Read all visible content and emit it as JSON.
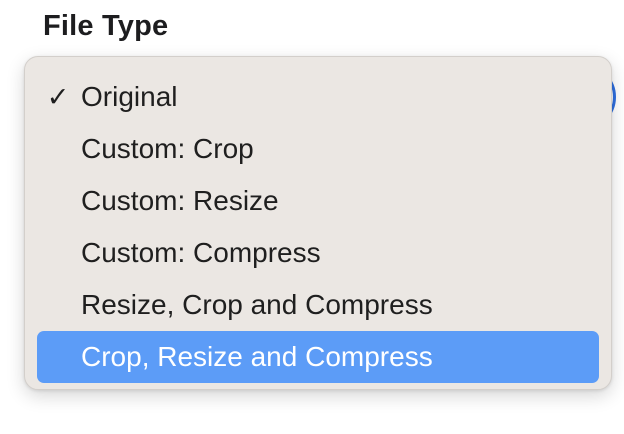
{
  "section": {
    "label": "File Type"
  },
  "menu": {
    "checked_index": 0,
    "highlighted_index": 5,
    "check_glyph": "✓",
    "items": [
      {
        "label": "Original"
      },
      {
        "label": "Custom: Crop"
      },
      {
        "label": "Custom: Resize"
      },
      {
        "label": "Custom: Compress"
      },
      {
        "label": "Resize, Crop and Compress"
      },
      {
        "label": "Crop, Resize and Compress"
      }
    ]
  },
  "colors": {
    "highlight": "#5c9cf7",
    "menu_background": "#ebe7e3",
    "accent_ring": "#2f6fe0"
  }
}
